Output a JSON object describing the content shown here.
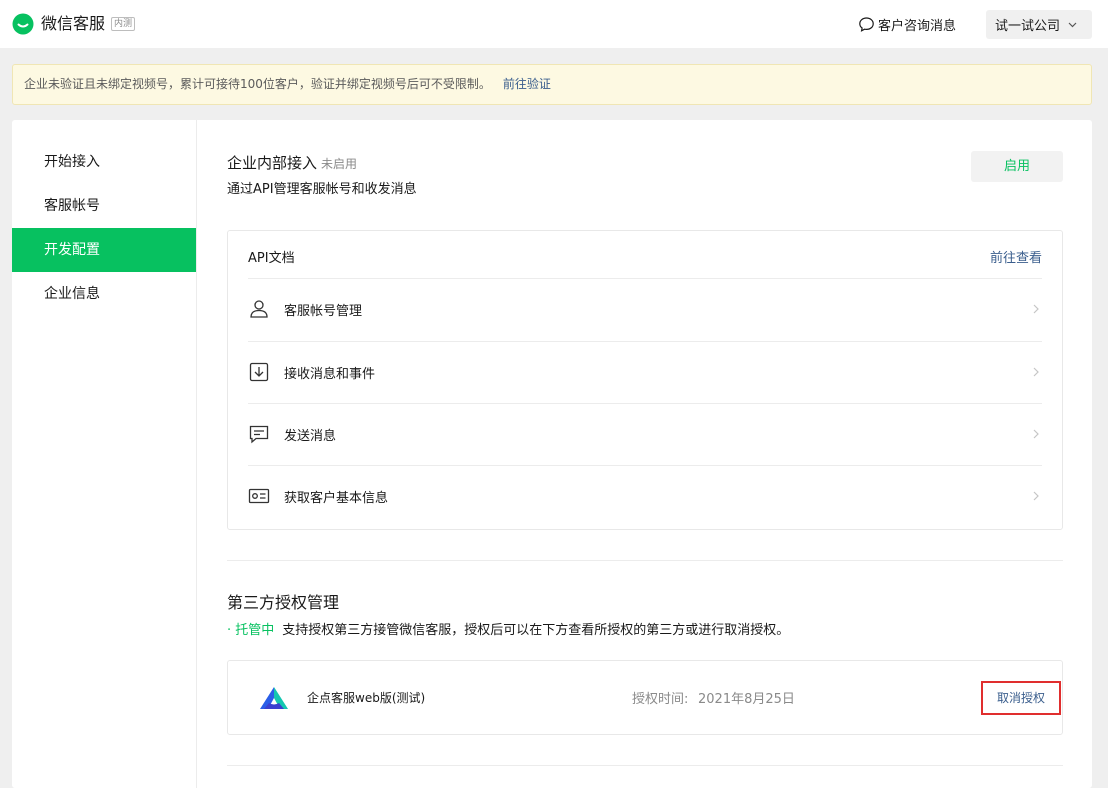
{
  "header": {
    "app_title": "微信客服",
    "beta_badge": "内测",
    "consult_link": "客户咨询消息",
    "company": "试一试公司",
    "icons": {
      "logo": "wechat-kefu-logo-icon",
      "consult": "chat-bubble-icon",
      "company_dropdown": "chevron-down-icon"
    },
    "brand_color": "#07c160"
  },
  "notice": {
    "text": "企业未验证且未绑定视频号，累计可接待100位客户，验证并绑定视频号后可不受限制。",
    "link": "前往验证"
  },
  "sidebar": {
    "items": [
      {
        "label": "开始接入",
        "active": false
      },
      {
        "label": "客服帐号",
        "active": false
      },
      {
        "label": "开发配置",
        "active": true
      },
      {
        "label": "企业信息",
        "active": false
      }
    ]
  },
  "internal": {
    "title": "企业内部接入",
    "status": "未启用",
    "desc": "通过API管理客服帐号和收发消息",
    "enable_button": "启用"
  },
  "api": {
    "header": "API文档",
    "goto": "前往查看",
    "items": [
      {
        "label": "客服帐号管理",
        "icon": "user-icon"
      },
      {
        "label": "接收消息和事件",
        "icon": "download-box-icon"
      },
      {
        "label": "发送消息",
        "icon": "message-icon"
      },
      {
        "label": "获取客户基本信息",
        "icon": "id-card-icon"
      }
    ]
  },
  "third_party": {
    "title": "第三方授权管理",
    "status": "· 托管中",
    "desc": "支持授权第三方接管微信客服，授权后可以在下方查看所授权的第三方或进行取消授权。",
    "entry": {
      "name": "企点客服web版(测试)",
      "auth_time_label": "授权时间:",
      "auth_time_value": "2021年8月25日",
      "revoke_button": "取消授权",
      "icon": "qidian-logo-icon"
    }
  }
}
